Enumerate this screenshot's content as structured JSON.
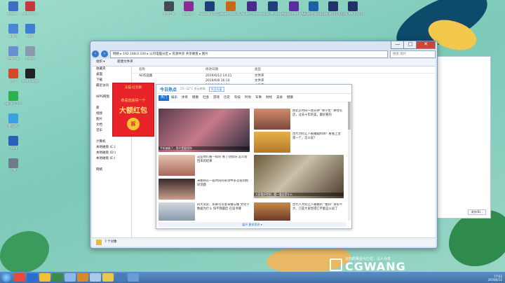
{
  "desktop": {
    "left_icons": [
      {
        "label": "Adobe...",
        "color": "#3a6fc4"
      },
      {
        "label": "Adobe Acr...",
        "color": "#c23a3a"
      },
      {
        "label": "计算机",
        "color": "#4a86d8"
      },
      {
        "label": "网络",
        "color": "#3d7fd4"
      },
      {
        "label": "控制面板",
        "color": "#6a8fd0"
      },
      {
        "label": "回收站",
        "color": "#8a9aae"
      },
      {
        "label": "PPT",
        "color": "#d04a2a"
      },
      {
        "label": "FontRooms",
        "color": "#222222"
      },
      {
        "label": "360安全卫士",
        "color": "#2bb24c"
      },
      {
        "label": "腾讯QQ",
        "color": "#3aa0e6"
      },
      {
        "label": "Word",
        "color": "#2b5fb8"
      },
      {
        "label": "设置",
        "color": "#707a88"
      }
    ],
    "top_icons": [
      {
        "label": "截图工具",
        "color": "#444a55"
      },
      {
        "label": "Adobe...",
        "color": "#8a2a9a"
      },
      {
        "label": "Photoshop CC 2019",
        "color": "#1f3f7a"
      },
      {
        "label": "Adobe Illustra...",
        "color": "#c8681a"
      },
      {
        "label": "Adobe Premie...",
        "color": "#4a2a8a"
      },
      {
        "label": "Adobe Media Enc...",
        "color": "#1f3f7a"
      },
      {
        "label": "Adobe After Effects...",
        "color": "#5a2aa0"
      },
      {
        "label": "Adobe Photoshop...",
        "color": "#1f5fa8"
      },
      {
        "label": "CINEMA 4D R19",
        "color": "#23306a"
      },
      {
        "label": "CINEMA 4D R19",
        "color": "#23306a"
      }
    ]
  },
  "explorer": {
    "minimize": "—",
    "maximize": "□",
    "close": "✕",
    "back": "‹",
    "forward": "›",
    "address": "网络 ▸ 192.168.0.104 ▸ 公司电脑分区 ▸ 资源共享 共享硬盘 ▸ 图片",
    "search_placeholder": "搜索 图片",
    "toolbar": [
      "组织 ▾",
      "新建文件夹"
    ],
    "nav_pane": [
      "收藏夹",
      "桌面",
      "下载",
      "最近访问",
      "",
      "WPS网盘",
      "",
      "库",
      "视频",
      "图片",
      "文档",
      "音乐",
      "",
      "计算机",
      "本地磁盘 (C:)",
      "本地磁盘 (D:)",
      "本地磁盘 (E:)",
      "",
      "网络"
    ],
    "columns": [
      "名称",
      "修改日期",
      "类型"
    ],
    "files": [
      {
        "name": "AE作品集",
        "date": "2019/6/12 14:21",
        "type": "文件夹"
      },
      {
        "name": "",
        "date": "2019/6/8 16:10",
        "type": "文件夹"
      },
      {
        "name": "",
        "date": "2019/6/5 14:54",
        "type": "文件夹"
      }
    ],
    "status": "7 个对象"
  },
  "redpacket": {
    "title": "天猫·红包雨",
    "line1": "恭喜您获得一个",
    "line2": "大额红包",
    "open": "拆"
  },
  "news": {
    "logo": "今日热点",
    "subtitle": "25~32°C 多云转晴",
    "button": "今日头条",
    "tabs": [
      "热门",
      "娱乐",
      "体育",
      "健康",
      "社会",
      "游戏",
      "历史",
      "科技",
      "时尚",
      "军事",
      "财经",
      "美食",
      "健康"
    ],
    "items": [
      {
        "caption": "手机被偷了，我不是要怪你"
      },
      {
        "text": "原北京时间一周分钟 \"称学生\" 拼住名店，过去十年的美，最好看的"
      },
      {
        "text": "古代为何让人被婚姻所绑？看看上皇第一个，怎么说？"
      },
      {
        "text": "这些你们看一样的 看了别惊讶 怎么会回来的结果"
      },
      {
        "caption": "大家看好得到...看一看这是什么"
      },
      {
        "text": "米娜将在一段时间的采访中多次说到相同话题"
      },
      {
        "text": "四大资史、如果可以意来做与做 文化学数据为什么 快不我最后 在读书哪"
      },
      {
        "text": "古代人为何让人被婚的 \"拍四\" 身份不大，只是大家觉得它不能这么说了"
      }
    ],
    "more": "展开 更多资讯 ▾"
  },
  "right_window": {
    "button": "浏览(B)..."
  },
  "taskbar": {
    "clock_time": "17:02",
    "clock_date": "2019/6/12"
  },
  "watermark": {
    "line1": "以你的事业为己任，以人为本",
    "line2": "CGWANG"
  }
}
